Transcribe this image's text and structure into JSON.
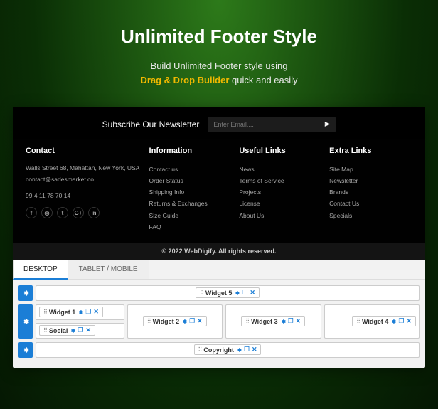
{
  "hero": {
    "title": "Unlimited Footer Style",
    "line1": "Build Unlimited Footer style using",
    "accent": "Drag & Drop Builder",
    "line2_rest": " quick and easily"
  },
  "newsletter": {
    "label": "Subscribe Our Newsletter",
    "placeholder": "Enter Email....",
    "submit_icon": "paper-plane"
  },
  "footer": {
    "contact": {
      "heading": "Contact",
      "address": "Walls Street 68, Mahattan, New York, USA",
      "email": "contact@sadesmarket.co",
      "phone": "99 4 11 78 70 14",
      "socials": [
        "f",
        "◎",
        "t",
        "G+",
        "in"
      ]
    },
    "info": {
      "heading": "Information",
      "items": [
        "Contact us",
        "Order Status",
        "Shipping Info",
        "Returns & Exchanges",
        "Size Guide",
        "FAQ"
      ]
    },
    "useful": {
      "heading": "Useful Links",
      "items": [
        "News",
        "Terms of Service",
        "Projects",
        "License",
        "About Us"
      ]
    },
    "extra": {
      "heading": "Extra Links",
      "items": [
        "Site Map",
        "Newsletter",
        "Brands",
        "Contact Us",
        "Specials"
      ]
    },
    "copyright": "© 2022 WebDigify. All rights reserved."
  },
  "builder": {
    "tabs": {
      "desktop": "DESKTOP",
      "mobile": "TABLET / MOBILE"
    },
    "widgets": {
      "w1": "Widget 1",
      "w2": "Widget 2",
      "w3": "Widget 3",
      "w4": "Widget 4",
      "w5": "Widget 5",
      "social": "Social",
      "copyright": "Copyright"
    },
    "controls": {
      "clone": "❐",
      "close": "✕"
    }
  }
}
